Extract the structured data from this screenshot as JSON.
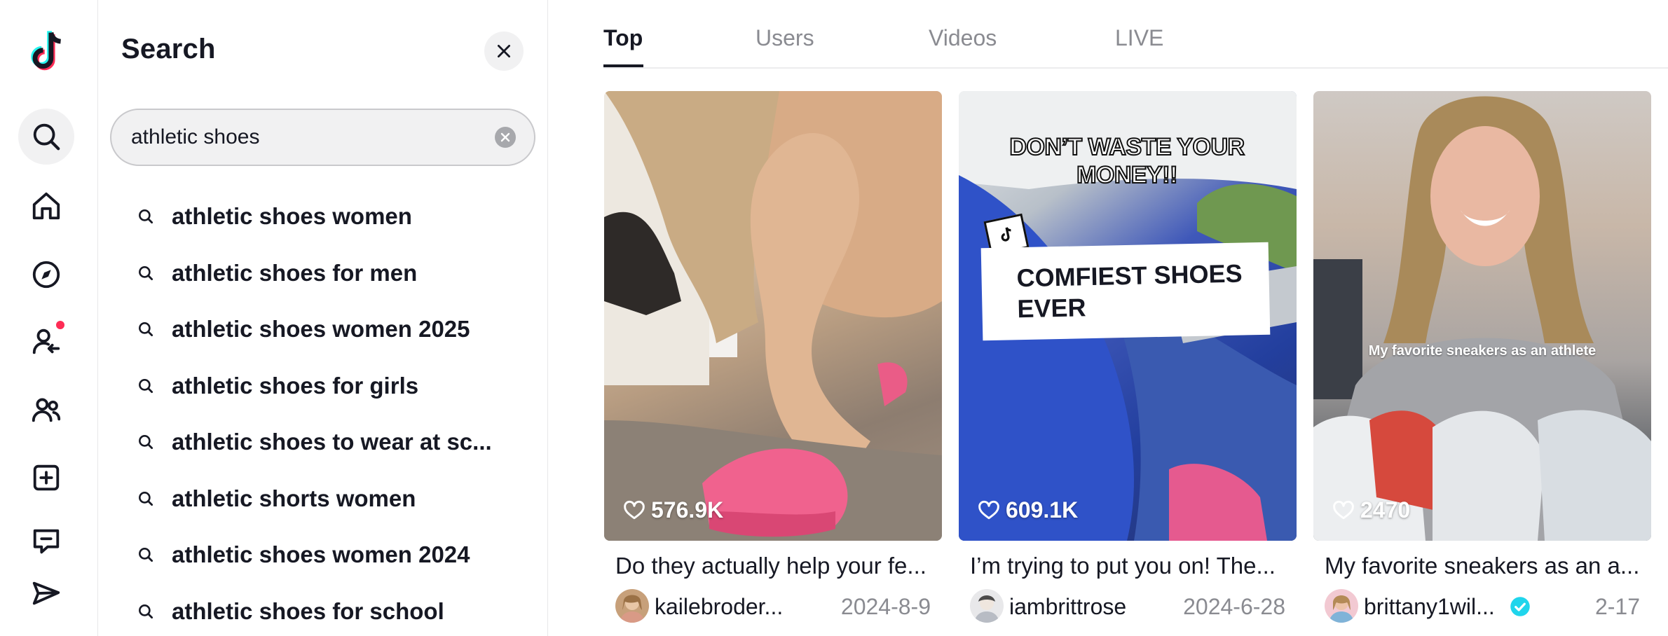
{
  "panel": {
    "title": "Search",
    "search": {
      "value": "athletic shoes"
    },
    "suggestions": [
      "athletic shoes women",
      "athletic shoes for men",
      "athletic shoes women 2025",
      "athletic shoes for girls",
      "athletic shoes to wear at sc...",
      "athletic shorts women",
      "athletic shoes women 2024",
      "athletic shoes for school"
    ]
  },
  "rail": {
    "items": [
      "tiktok-logo-icon",
      "search-icon",
      "home-icon",
      "compass-icon",
      "following-icon",
      "friends-icon",
      "upload-icon",
      "inbox-icon",
      "send-icon"
    ]
  },
  "tabs": [
    "Top",
    "Users",
    "Videos",
    "LIVE"
  ],
  "videos": [
    {
      "likes": "576.9K",
      "caption": "Do they actually help your fe...",
      "author": "kailebroder...",
      "date": "2024-8-9",
      "verified": false
    },
    {
      "likes": "609.1K",
      "caption": "I’m trying to put you on! The...",
      "author": "iambrittrose",
      "date": "2024-6-28",
      "verified": false,
      "overlay_top": "DON’T WASTE YOUR MONEY!!",
      "overlay_box": "COMFIEST SHOES EVER"
    },
    {
      "likes": "2470",
      "caption": "My favorite sneakers as an a...",
      "author": "brittany1wil...",
      "date": "2-17",
      "verified": true,
      "overlay": "My favorite sneakers as an athlete"
    }
  ],
  "colors": {
    "accent": "#fe2c55",
    "verified": "#20d5ec",
    "text": "#161823",
    "muted": "#8a8b91"
  }
}
